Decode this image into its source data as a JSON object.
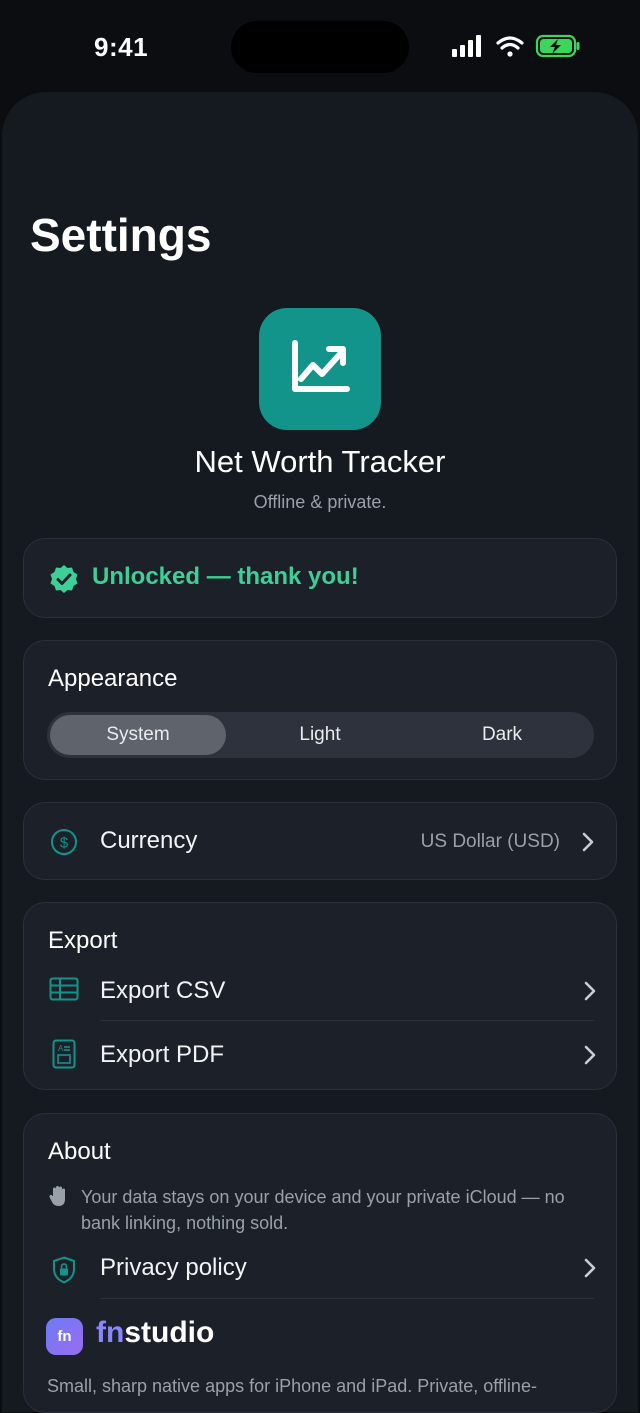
{
  "status_bar": {
    "time": "9:41"
  },
  "page_title": "Settings",
  "app": {
    "name": "Net Worth Tracker",
    "tagline": "Offline & private."
  },
  "unlocked": {
    "text": "Unlocked — thank you!"
  },
  "appearance": {
    "title": "Appearance",
    "options": [
      "System",
      "Light",
      "Dark"
    ],
    "selected": "System"
  },
  "currency": {
    "label": "Currency",
    "value": "US Dollar (USD)"
  },
  "export": {
    "title": "Export",
    "csv_label": "Export CSV",
    "pdf_label": "Export PDF"
  },
  "about": {
    "title": "About",
    "data_note": "Your data stays on your device and your private iCloud — no bank linking, nothing sold.",
    "privacy_label": "Privacy policy",
    "studio_logo": "fn",
    "studio_name_part1": "fn",
    "studio_name_part2": "studio",
    "studio_description": "Small, sharp native apps for iPhone and iPad. Private, offline-"
  },
  "colors": {
    "accent_teal": "#12948a",
    "success_green": "#3dcf95",
    "studio_purple": "#8a86ff"
  },
  "icons": {
    "unlocked": "check-badge-icon",
    "currency": "dollar-circle-icon",
    "csv": "table-icon",
    "pdf": "document-icon",
    "privacy": "shield-lock-icon",
    "about_note": "hand-icon",
    "chevron": "chevron-right-icon"
  }
}
